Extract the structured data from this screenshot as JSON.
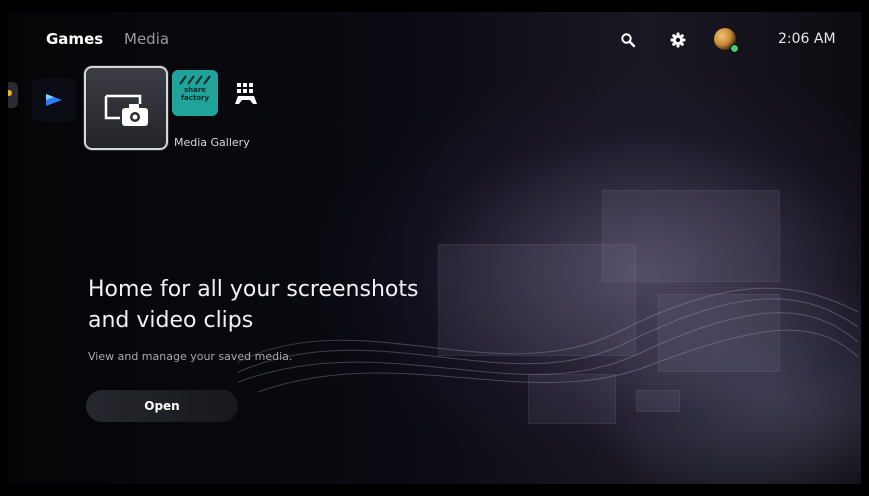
{
  "header": {
    "tabs": [
      {
        "label": "Games",
        "active": true
      },
      {
        "label": "Media",
        "active": false
      }
    ],
    "icons": [
      "search-icon",
      "gear-icon"
    ],
    "clock": "2:06 AM",
    "avatar_status_color": "#3bd16f"
  },
  "app_row": {
    "selected_label": "Media Gallery",
    "share_factory_text": "share factory",
    "tiles": [
      "partial-app-tile",
      "playstation-plus-icon",
      "media-gallery-icon",
      "share-factory-icon",
      "game-controller-icon"
    ]
  },
  "hero": {
    "title_line1": "Home for all your screenshots",
    "title_line2": "and video clips",
    "subtitle": "View and manage your saved media.",
    "button_label": "Open"
  },
  "colors": {
    "accent_teal": "#1fa39a",
    "psplus_yellow": "#f2b51a",
    "text_primary": "#f2f2f4",
    "text_muted": "#9a9aa2"
  }
}
